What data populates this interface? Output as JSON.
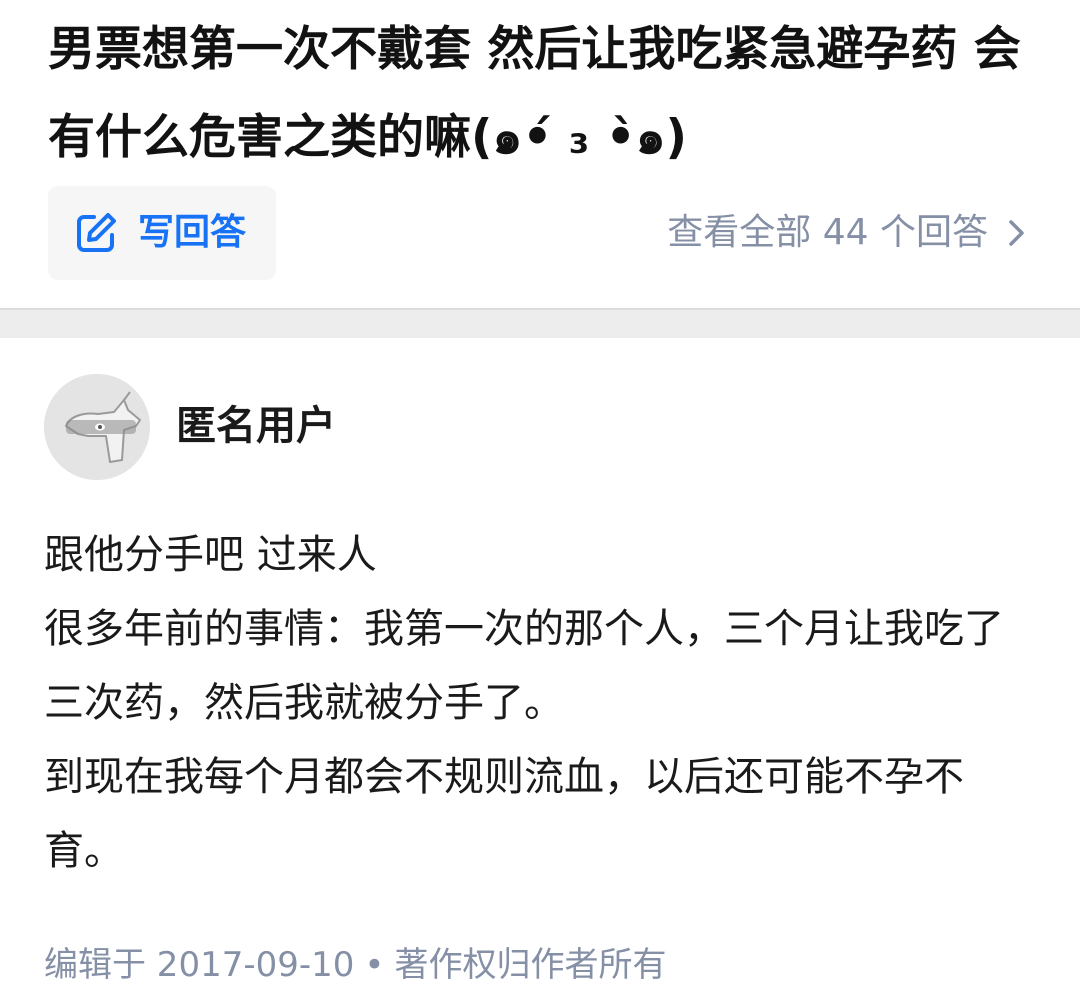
{
  "question": {
    "title": "男票想第一次不戴套 然后让我吃紧急避孕药 会有什么危害之类的嘛(๑•́ ₃ •̀๑)",
    "write_answer_label": "写回答",
    "view_all_label": "查看全部 44 个回答",
    "write_icon": "pen-square-icon",
    "chevron_icon": "chevron-right-icon"
  },
  "answer": {
    "author_name": "匿名用户",
    "avatar_icon": "anonymous-avatar",
    "paragraphs": [
      "跟他分手吧 过来人",
      "很多年前的事情：我第一次的那个人，三个月让我吃了三次药，然后我就被分手了。",
      "到现在我每个月都会不规则流血，以后还可能不孕不育。"
    ],
    "edited_label": "编辑于 2017-09-10",
    "separator": "•",
    "copyright_label": "著作权归作者所有"
  },
  "colors": {
    "accent": "#1772f6",
    "muted": "#8590a6",
    "button_bg": "#f6f6f6",
    "divider_bg": "#ededed"
  }
}
